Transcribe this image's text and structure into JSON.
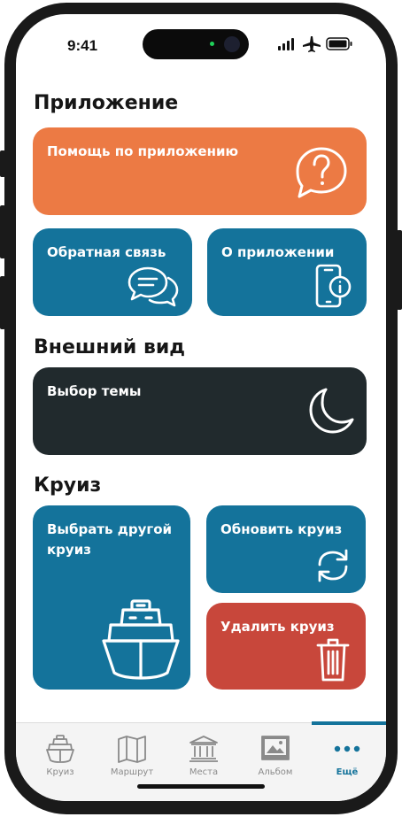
{
  "status_bar": {
    "time": "9:41"
  },
  "sections": {
    "app": {
      "title": "Приложение",
      "help": "Помощь по приложению",
      "feedback": "Обратная связь",
      "about": "О приложении"
    },
    "appearance": {
      "title": "Внешний вид",
      "theme": "Выбор темы"
    },
    "cruise": {
      "title": "Круиз",
      "choose_other": "Выбрать другой круиз",
      "update": "Обновить круиз",
      "delete": "Удалить круиз"
    }
  },
  "tabbar": {
    "items": [
      {
        "label": "Круиз",
        "icon": "ship-icon"
      },
      {
        "label": "Маршрут",
        "icon": "map-icon"
      },
      {
        "label": "Места",
        "icon": "museum-icon"
      },
      {
        "label": "Альбом",
        "icon": "photo-album-icon"
      },
      {
        "label": "Ещё",
        "icon": "more-dots-icon"
      }
    ],
    "active_index": 4
  },
  "colors": {
    "orange": "#ec7a44",
    "blue": "#14739b",
    "dark": "#212a2d",
    "red": "#c8473b"
  }
}
